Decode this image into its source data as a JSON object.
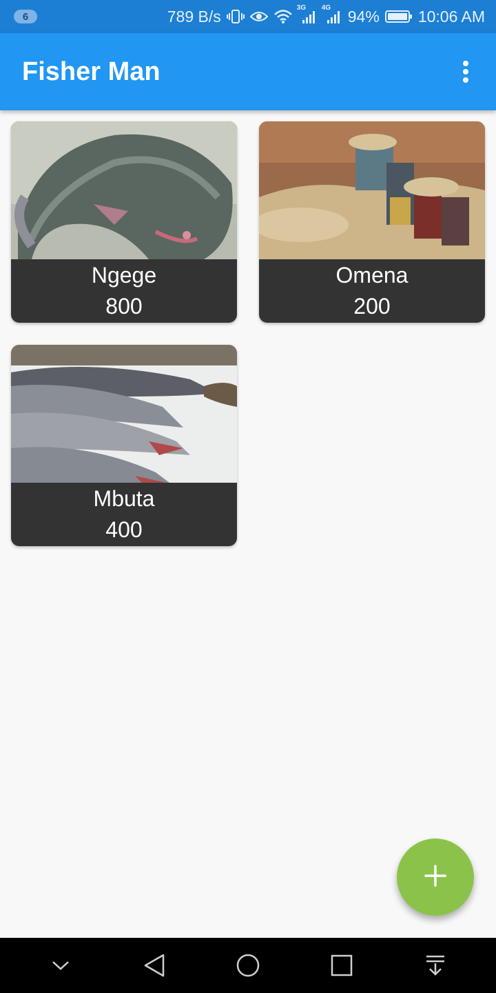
{
  "status_bar": {
    "notification_count": "6",
    "network_speed": "789 B/s",
    "signal_1_label": "3G",
    "signal_2_label": "4G",
    "battery": "94%",
    "time": "10:06 AM"
  },
  "app_bar": {
    "title": "Fisher Man",
    "menu_icon": "more-vert-icon"
  },
  "fish_items": [
    {
      "name": "Ngege",
      "price": "800"
    },
    {
      "name": "Omena",
      "price": "200"
    },
    {
      "name": "Mbuta",
      "price": "400"
    }
  ],
  "fab": {
    "icon": "add-icon",
    "color": "#8bc34a"
  },
  "nav_bar": {
    "icons": [
      "chevron-down-icon",
      "back-icon",
      "home-icon",
      "recents-icon",
      "notification-pull-icon"
    ]
  },
  "colors": {
    "status_bar": "#1c7fd4",
    "app_bar": "#2196f3",
    "card_caption": "#333333",
    "background": "#f8f8f8"
  }
}
